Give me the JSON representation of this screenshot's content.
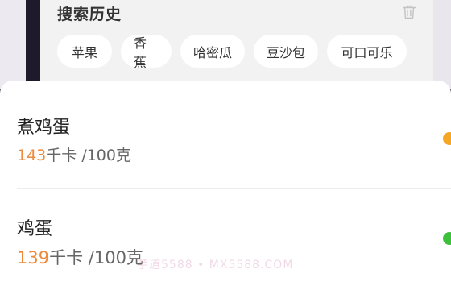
{
  "history": {
    "title": "搜索历史",
    "chips": [
      "苹果",
      "香蕉",
      "哈密瓜",
      "豆沙包",
      "可口可乐"
    ]
  },
  "foods": [
    {
      "name": "煮鸡蛋",
      "kcal": "143",
      "unit": "千卡",
      "per": " /100克",
      "dot_color": "#f5a623"
    },
    {
      "name": "鸡蛋",
      "kcal": "139",
      "unit": "千卡",
      "per": " /100克",
      "dot_color": "#3cc13b"
    }
  ],
  "watermark": "芋道5588 • MX5588.COM",
  "icons": {
    "delete": "trash-icon"
  },
  "colors": {
    "accent": "#ee8a3a",
    "chip_bg": "#ffffff",
    "panel_bg": "#f2f2f2"
  }
}
